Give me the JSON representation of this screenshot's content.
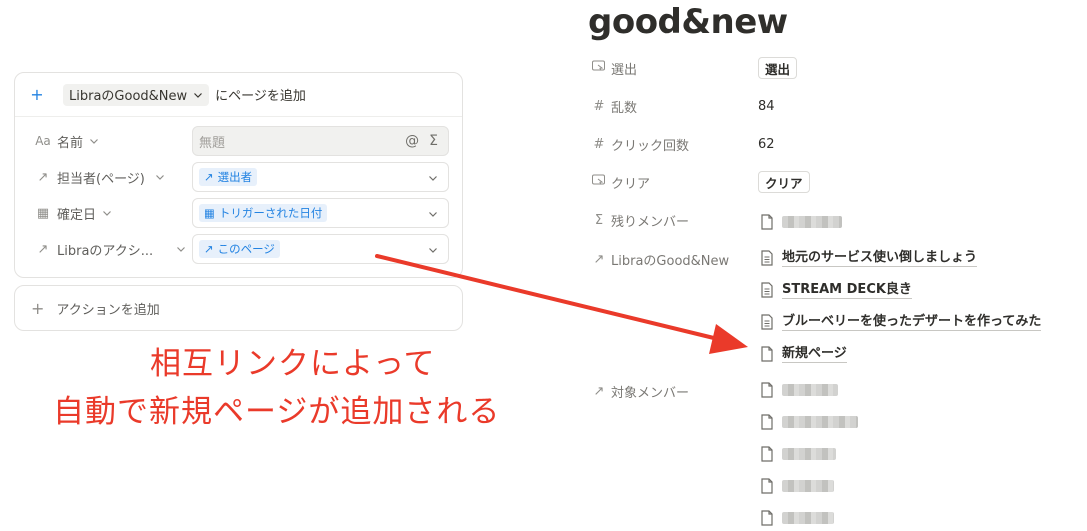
{
  "action_card": {
    "header": {
      "database_label": "LibraのGood&New",
      "suffix": "にページを追加"
    },
    "rows": [
      {
        "icon": "text-property-icon",
        "icon_glyph": "Aa",
        "label": "名前",
        "placeholder": "無題",
        "end_icons": [
          "@",
          "Σ"
        ]
      },
      {
        "icon": "relation-arrow-icon",
        "icon_glyph": "↗",
        "label": "担当者(ページ)",
        "value": "選出者",
        "value_icon": "↗"
      },
      {
        "icon": "calendar-icon",
        "icon_glyph": "▦",
        "label": "確定日",
        "value": "トリガーされた日付",
        "value_icon": "▦"
      },
      {
        "icon": "relation-arrow-icon",
        "icon_glyph": "↗",
        "label": "Libraのアクシ...",
        "value": "このページ",
        "value_icon": "↗"
      }
    ],
    "add_action_label": "アクションを追加"
  },
  "annotation": {
    "line1": "相互リンクによって",
    "line2": "自動で新規ページが追加される",
    "color": "#ea3a2a"
  },
  "page": {
    "title": "good&new",
    "properties": [
      {
        "icon": "button-property-icon",
        "icon_glyph": "⍈",
        "label": "選出",
        "type": "button",
        "value": "選出"
      },
      {
        "icon": "number-property-icon",
        "icon_glyph": "#",
        "label": "乱数",
        "type": "number",
        "value": "84"
      },
      {
        "icon": "number-property-icon",
        "icon_glyph": "#",
        "label": "クリック回数",
        "type": "number",
        "value": "62"
      },
      {
        "icon": "button-property-icon",
        "icon_glyph": "⍈",
        "label": "クリア",
        "type": "button",
        "value": "クリア"
      },
      {
        "icon": "formula-icon",
        "icon_glyph": "Σ",
        "label": "残りメンバー",
        "type": "blurred"
      },
      {
        "icon": "relation-arrow-icon",
        "icon_glyph": "↗",
        "label": "LibraのGood&New",
        "type": "relation",
        "items": [
          "地元のサービス使い倒しましょう",
          "STREAM DECK良き",
          "ブルーベリーを使ったデザートを作ってみた",
          "新規ページ"
        ]
      },
      {
        "icon": "relation-arrow-icon",
        "icon_glyph": "↗",
        "label": "対象メンバー",
        "type": "blurred-list"
      }
    ]
  },
  "colors": {
    "accent_blue": "#2383e2",
    "tag_bg": "#e7f0fb",
    "annotation_red": "#ea3a2a"
  }
}
